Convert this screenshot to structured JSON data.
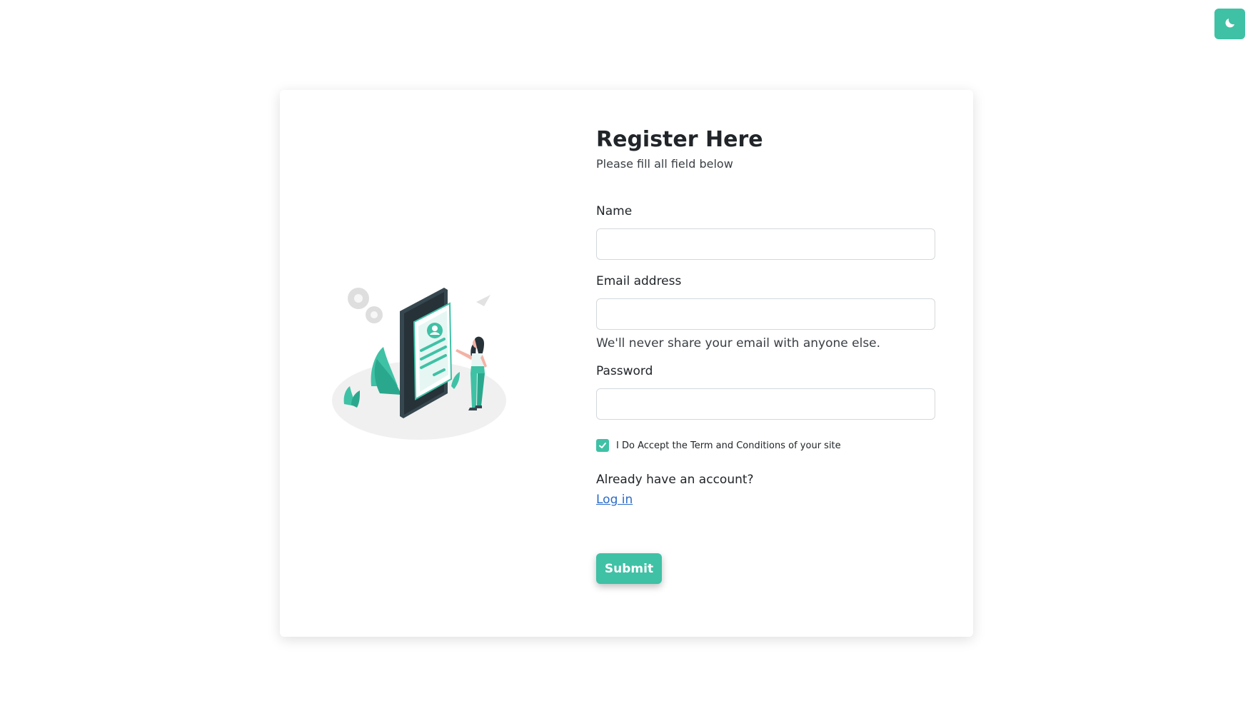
{
  "theme_toggle": {
    "icon": "moon-icon"
  },
  "form": {
    "title": "Register Here",
    "subtitle": "Please fill all field below",
    "name_label": "Name",
    "name_value": "",
    "email_label": "Email address",
    "email_value": "",
    "email_help": "We'll never share your email with anyone else.",
    "password_label": "Password",
    "password_value": "",
    "terms_label": "I Do Accept the Term and Conditions of your site",
    "terms_checked": true,
    "account_prompt": "Already have an account?",
    "login_link": "Log in",
    "submit_label": "Submit"
  },
  "colors": {
    "accent": "#3fc1a5",
    "link": "#2a6bc9"
  }
}
